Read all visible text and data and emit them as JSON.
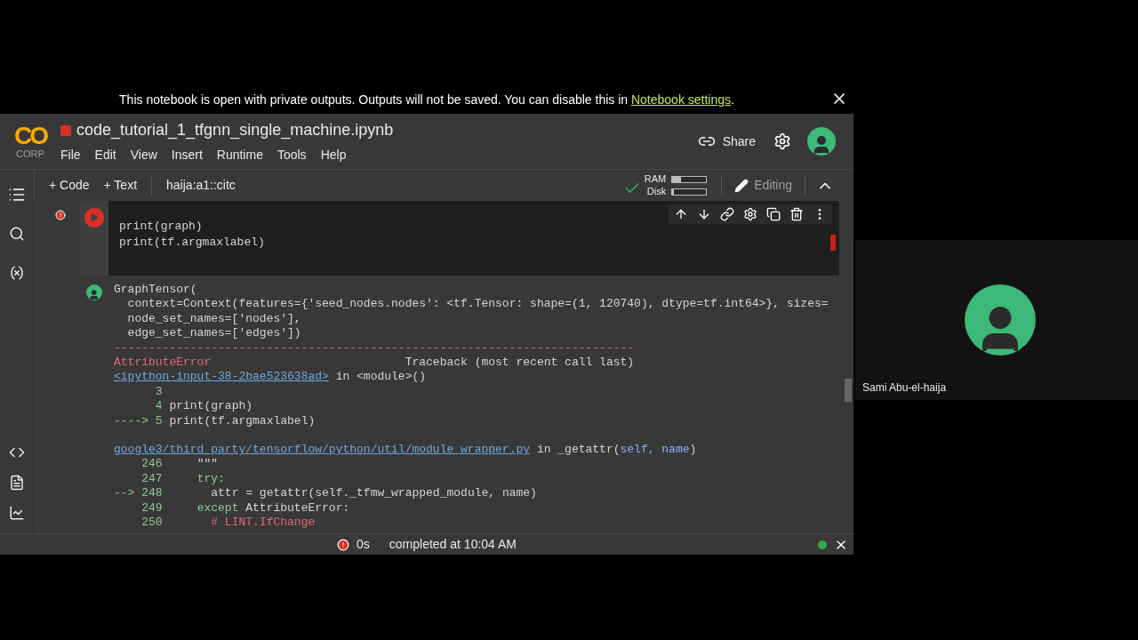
{
  "banner": {
    "text": "This notebook is open with private outputs. Outputs will not be saved. You can disable this in ",
    "link": "Notebook settings",
    "tail": "."
  },
  "header": {
    "logo": "CO",
    "logo_caption": "CORP",
    "title": "code_tutorial_1_tfgnn_single_machine.ipynb",
    "menu": [
      "File",
      "Edit",
      "View",
      "Insert",
      "Runtime",
      "Tools",
      "Help"
    ],
    "share": "Share"
  },
  "toolbar": {
    "add_code": "+ Code",
    "add_text": "+ Text",
    "branch": "haija:a1::citc",
    "connected": true,
    "meters": [
      {
        "label": "RAM",
        "level": 0.25
      },
      {
        "label": "Disk",
        "level": 0.06
      }
    ],
    "mode": "Editing"
  },
  "cell": {
    "error": true,
    "code": [
      "print(graph)",
      "print(tf.argmaxlabel)"
    ],
    "output": [
      {
        "lines": [
          {
            "segments": [
              {
                "kind": "plain",
                "text": "GraphTensor("
              }
            ]
          },
          {
            "segments": [
              {
                "kind": "plain",
                "text": "  context=Context(features={'seed_nodes.nodes': <tf.Tensor: shape=(1, 120740), dtype=tf.int64>}, sizes="
              }
            ]
          },
          {
            "segments": [
              {
                "kind": "plain",
                "text": "  node_set_names=['nodes'],"
              }
            ]
          },
          {
            "segments": [
              {
                "kind": "plain",
                "text": "  edge_set_names=['edges'])"
              }
            ]
          },
          {
            "segments": [
              {
                "kind": "red",
                "text": "---------------------------------------------------------------------------"
              }
            ]
          },
          {
            "segments": [
              {
                "kind": "red",
                "text": "AttributeError"
              },
              {
                "kind": "plain",
                "text": "                            Traceback (most recent call last)"
              }
            ]
          },
          {
            "segments": [
              {
                "kind": "link",
                "text": "<ipython-input-38-2bae523638ad>"
              },
              {
                "kind": "plain",
                "text": " in <module>()"
              }
            ]
          },
          {
            "segments": [
              {
                "kind": "green",
                "text": "      3"
              }
            ]
          },
          {
            "segments": [
              {
                "kind": "green",
                "text": "      4 "
              },
              {
                "kind": "plain",
                "text": "print(graph)"
              }
            ]
          },
          {
            "segments": [
              {
                "kind": "green",
                "text": "----> 5 "
              },
              {
                "kind": "plain",
                "text": "print(tf.argmaxlabel)"
              }
            ]
          }
        ]
      },
      {
        "lines": [
          {
            "segments": [
              {
                "kind": "link",
                "text": "google3/third_party/tensorflow/python/util/module_wrapper.py"
              },
              {
                "kind": "plain",
                "text": " in _getattr("
              },
              {
                "kind": "blue",
                "text": "self, name"
              },
              {
                "kind": "plain",
                "text": ")"
              }
            ]
          },
          {
            "segments": [
              {
                "kind": "green",
                "text": "    246 "
              },
              {
                "kind": "plain",
                "text": "    \"\"\""
              }
            ]
          },
          {
            "segments": [
              {
                "kind": "green",
                "text": "    247 "
              },
              {
                "kind": "green",
                "text": "    try:"
              }
            ]
          },
          {
            "segments": [
              {
                "kind": "green",
                "text": "--> 248 "
              },
              {
                "kind": "plain",
                "text": "      attr = getattr(self._tfmw_wrapped_module, name)"
              }
            ]
          },
          {
            "segments": [
              {
                "kind": "green",
                "text": "    249 "
              },
              {
                "kind": "green",
                "text": "    except"
              },
              {
                "kind": "plain",
                "text": " AttributeError:"
              }
            ]
          },
          {
            "segments": [
              {
                "kind": "green",
                "text": "    250 "
              },
              {
                "kind": "red",
                "text": "      # LINT.IfChange"
              }
            ]
          }
        ]
      }
    ]
  },
  "status_bar": {
    "error": true,
    "duration": "0s",
    "message": "completed at 10:04 AM",
    "connected": true
  },
  "participant": {
    "name": "Sami Abu-el-haija"
  }
}
